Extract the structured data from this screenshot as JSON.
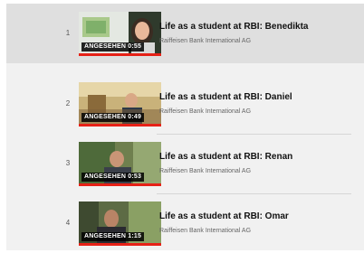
{
  "playlist": {
    "items": [
      {
        "index": "1",
        "title": "Life as a student at RBI: Benedikta",
        "channel": "Raiffeisen Bank International AG",
        "badge": "ANGESEHEN 0:55",
        "active": true
      },
      {
        "index": "2",
        "title": "Life as a student at RBI: Daniel",
        "channel": "Raiffeisen Bank International AG",
        "badge": "ANGESEHEN 0:49",
        "active": false
      },
      {
        "index": "3",
        "title": "Life as a student at RBI: Renan",
        "channel": "Raiffeisen Bank International AG",
        "badge": "ANGESEHEN 0:53",
        "active": false
      },
      {
        "index": "4",
        "title": "Life as a student at RBI: Omar",
        "channel": "Raiffeisen Bank International AG",
        "badge": "ANGESEHEN 1:15",
        "active": false
      }
    ]
  },
  "colors": {
    "progress": "#e62117",
    "active_row": "#dfdfdf",
    "panel": "#f1f1f1"
  }
}
